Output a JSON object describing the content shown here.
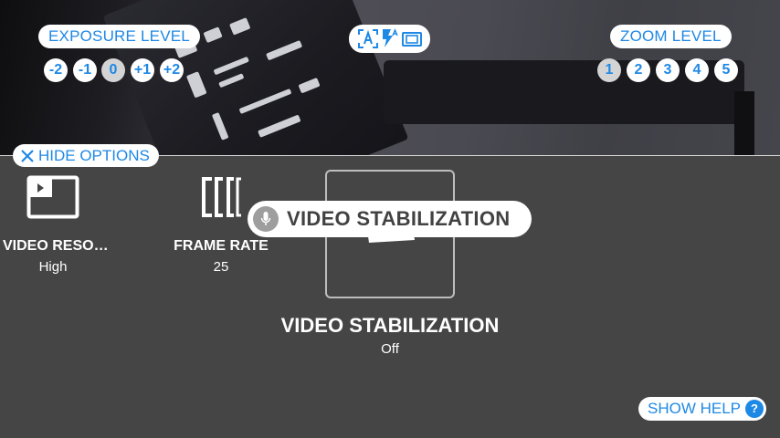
{
  "exposure": {
    "label": "EXPOSURE LEVEL",
    "levels": [
      "-2",
      "-1",
      "0",
      "+1",
      "+2"
    ],
    "selected": "0"
  },
  "zoom": {
    "label": "ZOOM LEVEL",
    "levels": [
      "1",
      "2",
      "3",
      "4",
      "5"
    ],
    "selected": "1"
  },
  "mode_icons": [
    "auto-scene-icon",
    "flash-auto-icon",
    "aspect-ratio-icon"
  ],
  "hide_options_label": "HIDE OPTIONS",
  "options": {
    "video_resolution": {
      "label": "VIDEO RESO…",
      "value": "High",
      "icon": "video-resolution-icon"
    },
    "frame_rate": {
      "label": "FRAME RATE",
      "value": "25",
      "icon": "frame-rate-icon"
    },
    "video_stabilization": {
      "label": "VIDEO STABILIZATION",
      "value": "Off",
      "icon": "video-stabilization-icon"
    }
  },
  "toast": {
    "text": "VIDEO STABILIZATION",
    "icon": "microphone-icon"
  },
  "show_help_label": "SHOW HELP",
  "colors": {
    "accent": "#1e88e5",
    "panel_bg": "#454545",
    "selected_chip": "#d4d4d4"
  }
}
